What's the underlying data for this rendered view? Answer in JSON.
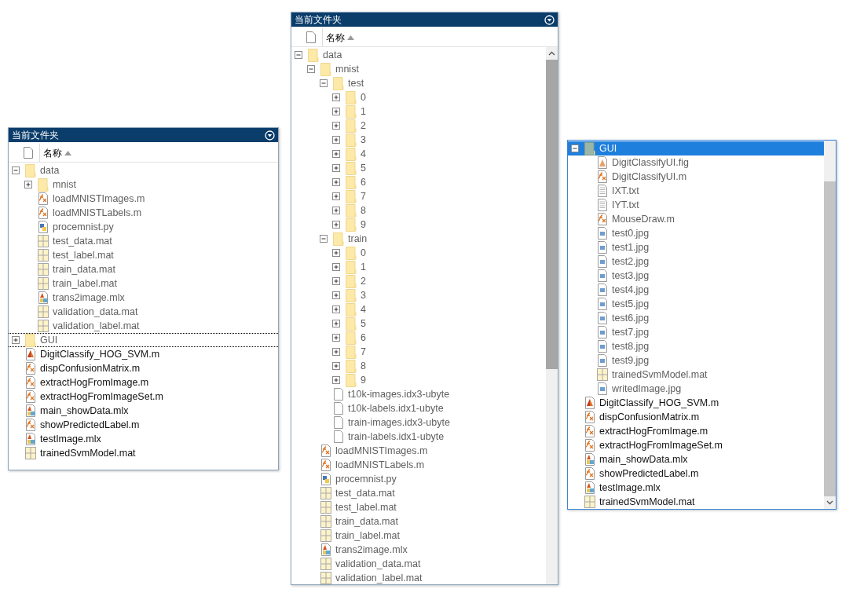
{
  "panels": [
    {
      "title": "当前文件夹",
      "header": {
        "label": "名称"
      },
      "active": false,
      "items": [
        {
          "name": "data",
          "kind": "folder",
          "expanded": true,
          "dimmed": true,
          "selected": false,
          "children": [
            {
              "name": "mnist",
              "kind": "folder",
              "expanded": false,
              "dimmed": true,
              "selected": false
            },
            {
              "name": "loadMNISTImages.m",
              "kind": "function",
              "dimmed": true,
              "selected": false
            },
            {
              "name": "loadMNISTLabels.m",
              "kind": "function",
              "dimmed": true,
              "selected": false
            },
            {
              "name": "procemnist.py",
              "kind": "python",
              "dimmed": true,
              "selected": false
            },
            {
              "name": "test_data.mat",
              "kind": "mat",
              "dimmed": true,
              "selected": false
            },
            {
              "name": "test_label.mat",
              "kind": "mat",
              "dimmed": true,
              "selected": false
            },
            {
              "name": "train_data.mat",
              "kind": "mat",
              "dimmed": true,
              "selected": false
            },
            {
              "name": "train_label.mat",
              "kind": "mat",
              "dimmed": true,
              "selected": false
            },
            {
              "name": "trans2image.mlx",
              "kind": "livescript",
              "dimmed": true,
              "selected": false
            },
            {
              "name": "validation_data.mat",
              "kind": "mat",
              "dimmed": true,
              "selected": false
            },
            {
              "name": "validation_label.mat",
              "kind": "mat",
              "dimmed": true,
              "selected": false
            }
          ]
        },
        {
          "name": "GUI",
          "kind": "folder",
          "expanded": false,
          "dimmed": true,
          "selected": true
        },
        {
          "name": "DigitClassify_HOG_SVM.m",
          "kind": "script",
          "dimmed": false,
          "selected": false
        },
        {
          "name": "dispConfusionMatrix.m",
          "kind": "function",
          "dimmed": false,
          "selected": false
        },
        {
          "name": "extractHogFromImage.m",
          "kind": "function",
          "dimmed": false,
          "selected": false
        },
        {
          "name": "extractHogFromImageSet.m",
          "kind": "function",
          "dimmed": false,
          "selected": false
        },
        {
          "name": "main_showData.mlx",
          "kind": "livescript",
          "dimmed": false,
          "selected": false
        },
        {
          "name": "showPredictedLabel.m",
          "kind": "function",
          "dimmed": false,
          "selected": false
        },
        {
          "name": "testImage.mlx",
          "kind": "livescript",
          "dimmed": false,
          "selected": false
        },
        {
          "name": "trainedSvmModel.mat",
          "kind": "mat",
          "dimmed": false,
          "selected": false
        }
      ]
    },
    {
      "title": "当前文件夹",
      "header": {
        "label": "名称"
      },
      "active": false,
      "items": [
        {
          "name": "data",
          "kind": "folder",
          "expanded": true,
          "dimmed": true,
          "selected": false,
          "children": [
            {
              "name": "mnist",
              "kind": "folder",
              "expanded": true,
              "dimmed": true,
              "selected": false,
              "children": [
                {
                  "name": "test",
                  "kind": "folder",
                  "expanded": true,
                  "dimmed": true,
                  "selected": false,
                  "children": [
                    {
                      "name": "0",
                      "kind": "folder",
                      "expanded": false,
                      "dimmed": true,
                      "selected": false
                    },
                    {
                      "name": "1",
                      "kind": "folder",
                      "expanded": false,
                      "dimmed": true,
                      "selected": false
                    },
                    {
                      "name": "2",
                      "kind": "folder",
                      "expanded": false,
                      "dimmed": true,
                      "selected": false
                    },
                    {
                      "name": "3",
                      "kind": "folder",
                      "expanded": false,
                      "dimmed": true,
                      "selected": false
                    },
                    {
                      "name": "4",
                      "kind": "folder",
                      "expanded": false,
                      "dimmed": true,
                      "selected": false
                    },
                    {
                      "name": "5",
                      "kind": "folder",
                      "expanded": false,
                      "dimmed": true,
                      "selected": false
                    },
                    {
                      "name": "6",
                      "kind": "folder",
                      "expanded": false,
                      "dimmed": true,
                      "selected": false
                    },
                    {
                      "name": "7",
                      "kind": "folder",
                      "expanded": false,
                      "dimmed": true,
                      "selected": false
                    },
                    {
                      "name": "8",
                      "kind": "folder",
                      "expanded": false,
                      "dimmed": true,
                      "selected": false
                    },
                    {
                      "name": "9",
                      "kind": "folder",
                      "expanded": false,
                      "dimmed": true,
                      "selected": false
                    }
                  ]
                },
                {
                  "name": "train",
                  "kind": "folder",
                  "expanded": true,
                  "dimmed": true,
                  "selected": false,
                  "children": [
                    {
                      "name": "0",
                      "kind": "folder",
                      "expanded": false,
                      "dimmed": true,
                      "selected": false
                    },
                    {
                      "name": "1",
                      "kind": "folder",
                      "expanded": false,
                      "dimmed": true,
                      "selected": false
                    },
                    {
                      "name": "2",
                      "kind": "folder",
                      "expanded": false,
                      "dimmed": true,
                      "selected": false
                    },
                    {
                      "name": "3",
                      "kind": "folder",
                      "expanded": false,
                      "dimmed": true,
                      "selected": false
                    },
                    {
                      "name": "4",
                      "kind": "folder",
                      "expanded": false,
                      "dimmed": true,
                      "selected": false
                    },
                    {
                      "name": "5",
                      "kind": "folder",
                      "expanded": false,
                      "dimmed": true,
                      "selected": false
                    },
                    {
                      "name": "6",
                      "kind": "folder",
                      "expanded": false,
                      "dimmed": true,
                      "selected": false
                    },
                    {
                      "name": "7",
                      "kind": "folder",
                      "expanded": false,
                      "dimmed": true,
                      "selected": false
                    },
                    {
                      "name": "8",
                      "kind": "folder",
                      "expanded": false,
                      "dimmed": true,
                      "selected": false
                    },
                    {
                      "name": "9",
                      "kind": "folder",
                      "expanded": false,
                      "dimmed": true,
                      "selected": false
                    }
                  ]
                },
                {
                  "name": "t10k-images.idx3-ubyte",
                  "kind": "file",
                  "dimmed": true,
                  "selected": false
                },
                {
                  "name": "t10k-labels.idx1-ubyte",
                  "kind": "file",
                  "dimmed": true,
                  "selected": false
                },
                {
                  "name": "train-images.idx3-ubyte",
                  "kind": "file",
                  "dimmed": true,
                  "selected": false
                },
                {
                  "name": "train-labels.idx1-ubyte",
                  "kind": "file",
                  "dimmed": true,
                  "selected": false
                }
              ]
            },
            {
              "name": "loadMNISTImages.m",
              "kind": "function",
              "dimmed": true,
              "selected": false
            },
            {
              "name": "loadMNISTLabels.m",
              "kind": "function",
              "dimmed": true,
              "selected": false
            },
            {
              "name": "procemnist.py",
              "kind": "python",
              "dimmed": true,
              "selected": false
            },
            {
              "name": "test_data.mat",
              "kind": "mat",
              "dimmed": true,
              "selected": false
            },
            {
              "name": "test_label.mat",
              "kind": "mat",
              "dimmed": true,
              "selected": false
            },
            {
              "name": "train_data.mat",
              "kind": "mat",
              "dimmed": true,
              "selected": false
            },
            {
              "name": "train_label.mat",
              "kind": "mat",
              "dimmed": true,
              "selected": false
            },
            {
              "name": "trans2image.mlx",
              "kind": "livescript",
              "dimmed": true,
              "selected": false
            },
            {
              "name": "validation_data.mat",
              "kind": "mat",
              "dimmed": true,
              "selected": false
            },
            {
              "name": "validation_label.mat",
              "kind": "mat",
              "dimmed": true,
              "selected": false
            }
          ]
        }
      ]
    },
    {
      "active": true,
      "items": [
        {
          "name": "GUI",
          "kind": "folder",
          "expanded": true,
          "dimmed": true,
          "selected": true,
          "children": [
            {
              "name": "DigitClassifyUI.fig",
              "kind": "figure",
              "dimmed": true,
              "selected": false
            },
            {
              "name": "DigitClassifyUI.m",
              "kind": "function",
              "dimmed": true,
              "selected": false
            },
            {
              "name": "IXT.txt",
              "kind": "text",
              "dimmed": true,
              "selected": false
            },
            {
              "name": "IYT.txt",
              "kind": "text",
              "dimmed": true,
              "selected": false
            },
            {
              "name": "MouseDraw.m",
              "kind": "function",
              "dimmed": true,
              "selected": false
            },
            {
              "name": "test0.jpg",
              "kind": "image",
              "dimmed": true,
              "selected": false
            },
            {
              "name": "test1.jpg",
              "kind": "image",
              "dimmed": true,
              "selected": false
            },
            {
              "name": "test2.jpg",
              "kind": "image",
              "dimmed": true,
              "selected": false
            },
            {
              "name": "test3.jpg",
              "kind": "image",
              "dimmed": true,
              "selected": false
            },
            {
              "name": "test4.jpg",
              "kind": "image",
              "dimmed": true,
              "selected": false
            },
            {
              "name": "test5.jpg",
              "kind": "image",
              "dimmed": true,
              "selected": false
            },
            {
              "name": "test6.jpg",
              "kind": "image",
              "dimmed": true,
              "selected": false
            },
            {
              "name": "test7.jpg",
              "kind": "image",
              "dimmed": true,
              "selected": false
            },
            {
              "name": "test8.jpg",
              "kind": "image",
              "dimmed": true,
              "selected": false
            },
            {
              "name": "test9.jpg",
              "kind": "image",
              "dimmed": true,
              "selected": false
            },
            {
              "name": "trainedSvmModel.mat",
              "kind": "mat",
              "dimmed": true,
              "selected": false
            },
            {
              "name": "writedImage.jpg",
              "kind": "image",
              "dimmed": true,
              "selected": false
            }
          ]
        },
        {
          "name": "DigitClassify_HOG_SVM.m",
          "kind": "script",
          "dimmed": false,
          "selected": false
        },
        {
          "name": "dispConfusionMatrix.m",
          "kind": "function",
          "dimmed": false,
          "selected": false
        },
        {
          "name": "extractHogFromImage.m",
          "kind": "function",
          "dimmed": false,
          "selected": false
        },
        {
          "name": "extractHogFromImageSet.m",
          "kind": "function",
          "dimmed": false,
          "selected": false
        },
        {
          "name": "main_showData.mlx",
          "kind": "livescript",
          "dimmed": false,
          "selected": false
        },
        {
          "name": "showPredictedLabel.m",
          "kind": "function",
          "dimmed": false,
          "selected": false
        },
        {
          "name": "testImage.mlx",
          "kind": "livescript",
          "dimmed": false,
          "selected": false
        },
        {
          "name": "trainedSvmModel.mat",
          "kind": "mat",
          "dimmed": false,
          "selected": false
        }
      ]
    }
  ]
}
